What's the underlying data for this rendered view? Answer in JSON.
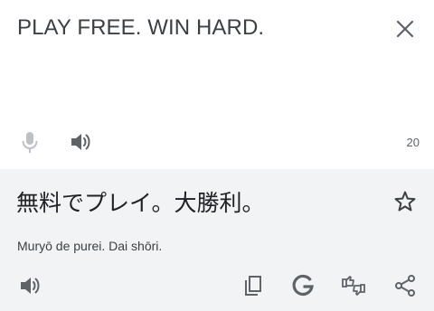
{
  "source": {
    "text": "PLAY FREE. WIN HARD.",
    "char_count": "20",
    "icons": {
      "close": "close-icon",
      "mic": "microphone-icon",
      "speaker": "speaker-icon"
    }
  },
  "result": {
    "text": "無料でプレイ。大勝利。",
    "transliteration": "Muryō de purei. Dai shōri.",
    "icons": {
      "star": "star-icon",
      "speaker": "speaker-icon",
      "copy": "copy-icon",
      "google": "google-g-icon",
      "feedback": "swap-thumbs-icon",
      "share": "share-icon"
    }
  },
  "colors": {
    "source_bg": "#ffffff",
    "result_bg": "#f1f3f4",
    "icon": "#5f6368",
    "icon_disabled": "#bdc1c6",
    "text": "#202124"
  }
}
